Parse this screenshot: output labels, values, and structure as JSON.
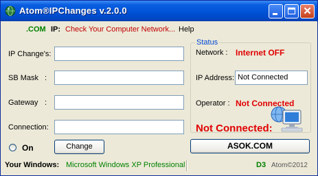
{
  "window": {
    "title": "Atom®IPChanges v.2.0.0"
  },
  "menu": {
    "com": ".COM",
    "ip": "IP:",
    "check": "Check Your Computer Network...",
    "help": "Help"
  },
  "form": {
    "ip_label": "IP Change's:",
    "ip_value": "",
    "mask_label": "SB Mask",
    "mask_colon": ":",
    "mask_value": "",
    "gateway_label": "Gateway",
    "gateway_colon": ":",
    "gateway_value": "",
    "connection_label": "Connection:",
    "connection_value": "",
    "radio_label": "On",
    "change_button": "Change"
  },
  "status": {
    "legend": "Status",
    "network_label": "Network :",
    "network_value": "Internet OFF",
    "ip_label": "IP Address:",
    "ip_value": "Not Connected",
    "operator_label": "Operator :",
    "operator_value": "Not Connected",
    "big_status": "Not Connected:",
    "asok_button": "ASOK.COM"
  },
  "statusbar": {
    "windows_label": "Your Windows:",
    "windows_value": "Microsoft Windows XP Professional",
    "d3": "D3",
    "copyright": "Atom©2012"
  },
  "colors": {
    "title_bar": "#0052d6",
    "red_status": "#e00000",
    "green": "#008000",
    "legend_blue": "#0046d5"
  }
}
